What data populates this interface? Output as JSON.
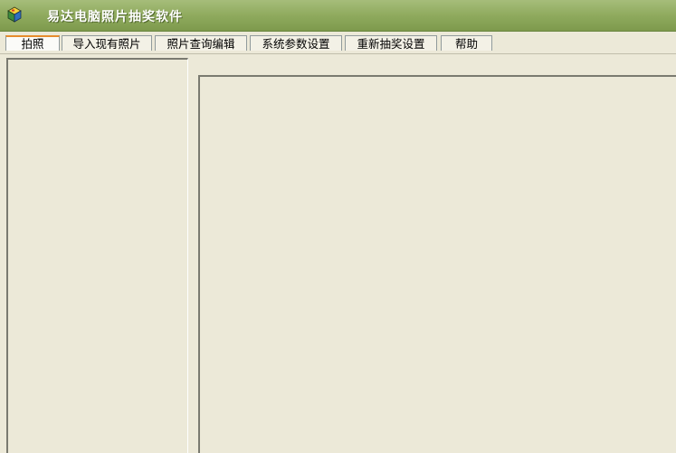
{
  "window": {
    "title": "易达电脑照片抽奖软件",
    "icon": "app-cube-icon"
  },
  "tabs": [
    {
      "label": "拍照",
      "active": true
    },
    {
      "label": "导入现有照片",
      "active": false
    },
    {
      "label": "照片查询编辑",
      "active": false
    },
    {
      "label": "系统参数设置",
      "active": false
    },
    {
      "label": "重新抽奖设置",
      "active": false
    },
    {
      "label": "帮助",
      "active": false
    }
  ],
  "colors": {
    "titlebar": "#8faa5e",
    "active_tab_accent": "#e68b2c",
    "background": "#ece9d8"
  }
}
